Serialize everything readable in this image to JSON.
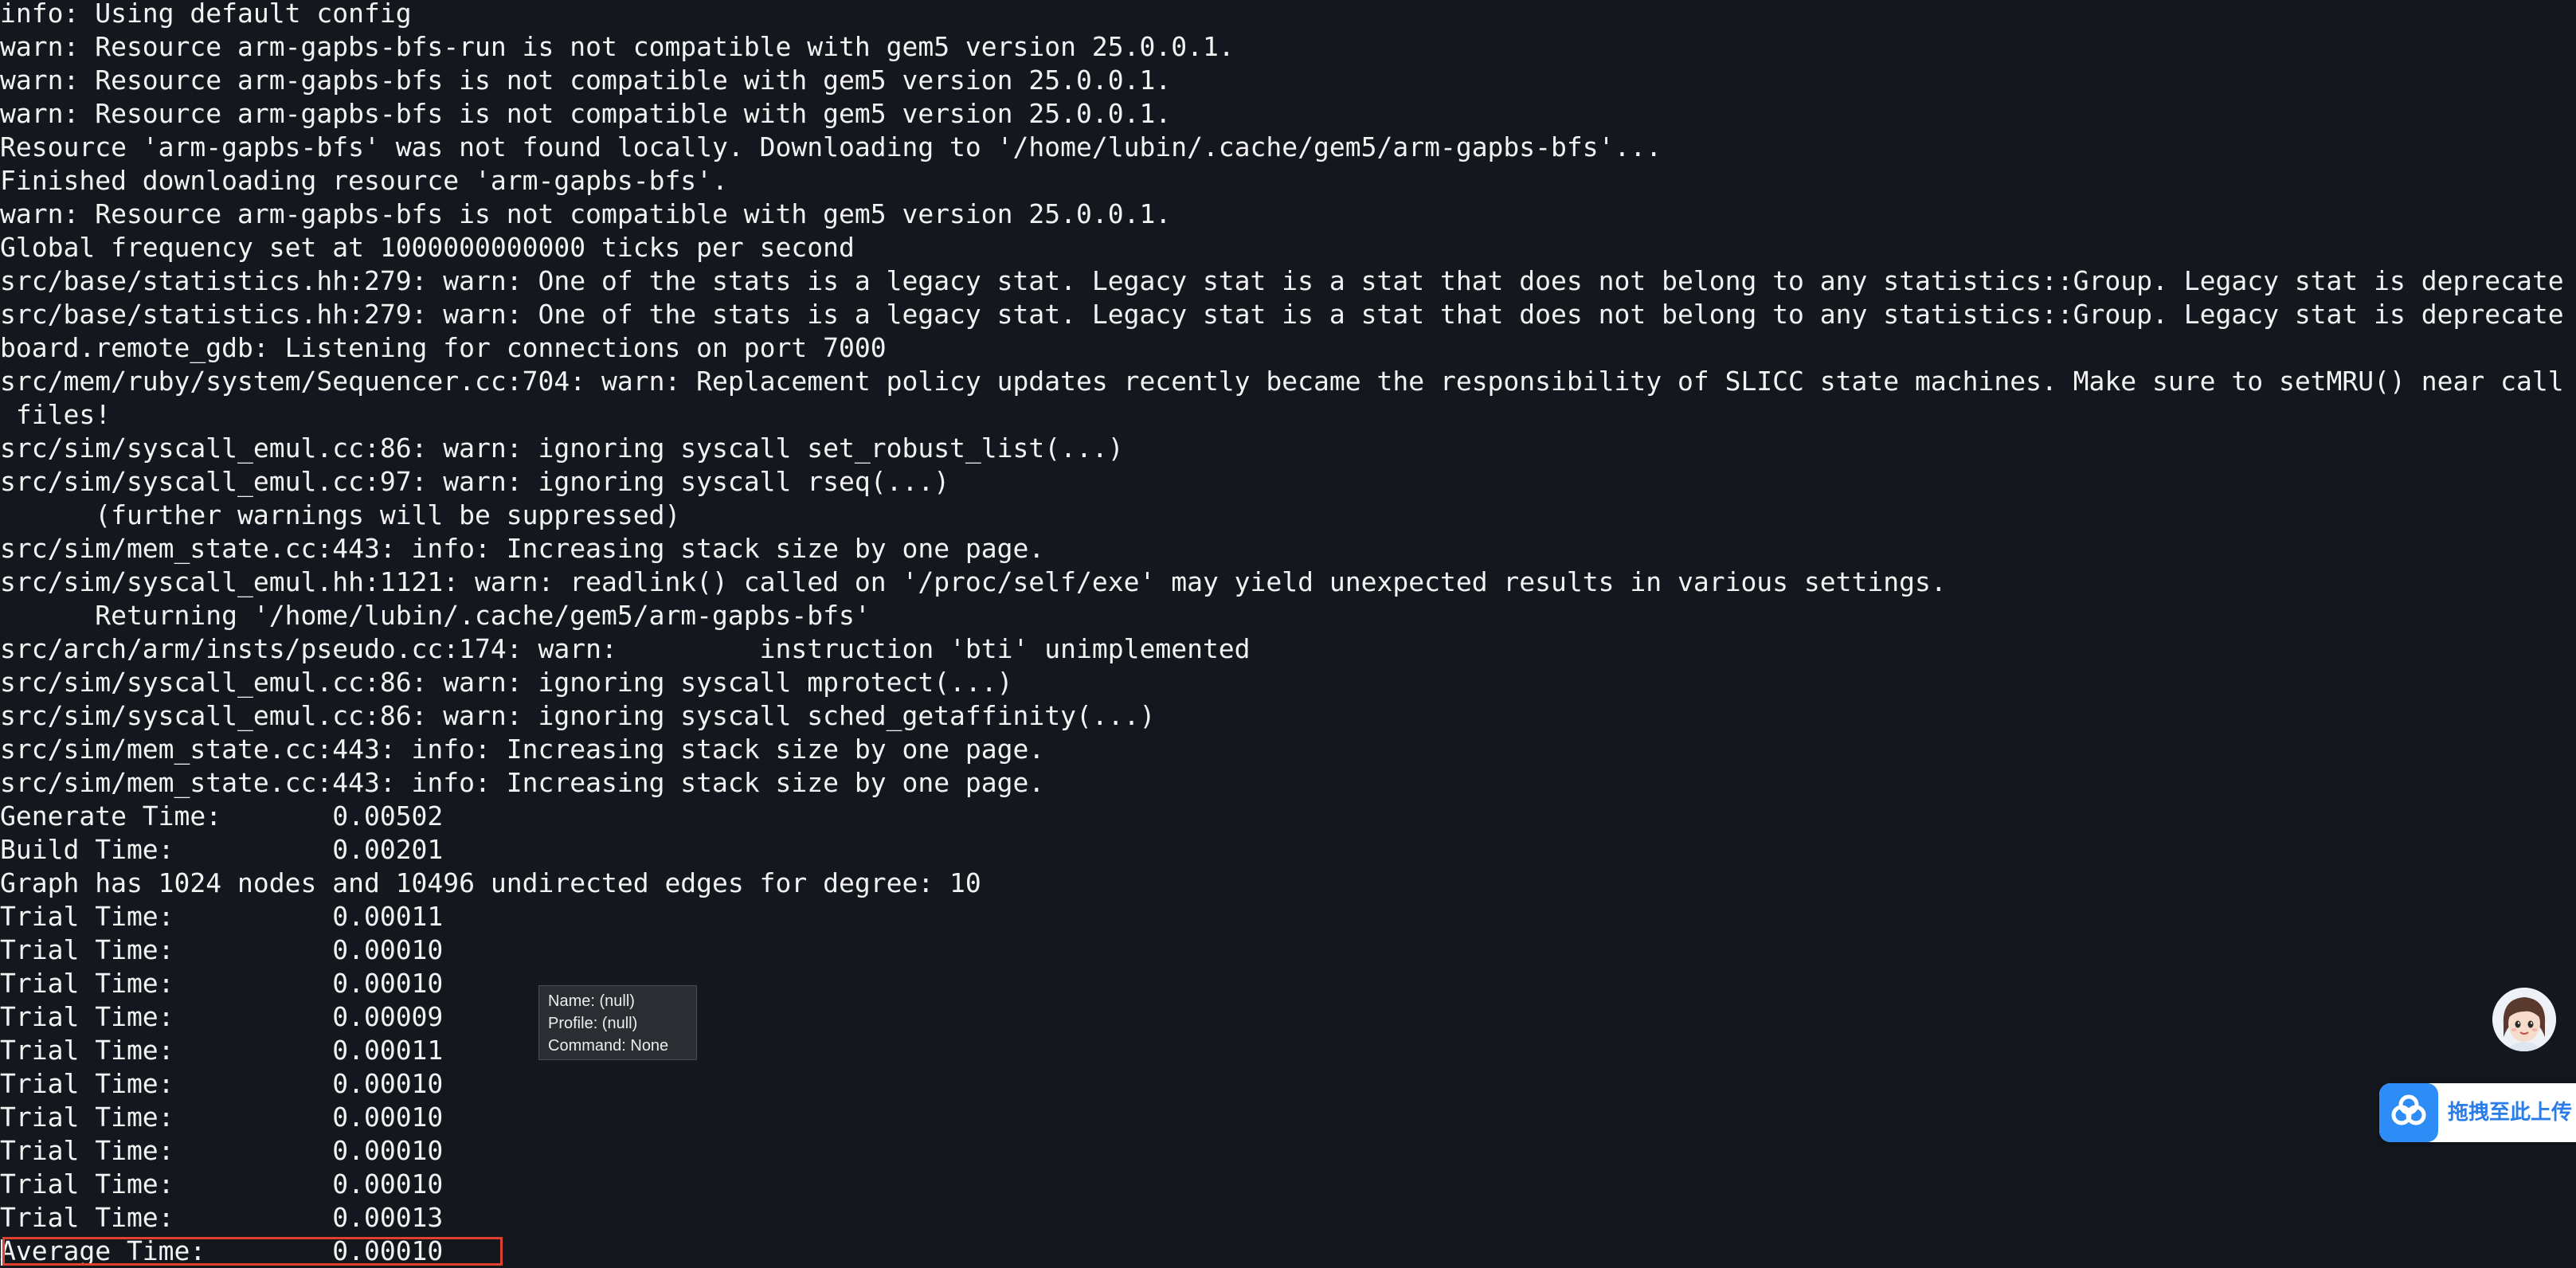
{
  "terminal": {
    "lines": [
      "info: Using default config",
      "warn: Resource arm-gapbs-bfs-run is not compatible with gem5 version 25.0.0.1.",
      "warn: Resource arm-gapbs-bfs is not compatible with gem5 version 25.0.0.1.",
      "warn: Resource arm-gapbs-bfs is not compatible with gem5 version 25.0.0.1.",
      "Resource 'arm-gapbs-bfs' was not found locally. Downloading to '/home/lubin/.cache/gem5/arm-gapbs-bfs'...",
      "Finished downloading resource 'arm-gapbs-bfs'.",
      "warn: Resource arm-gapbs-bfs is not compatible with gem5 version 25.0.0.1.",
      "Global frequency set at 1000000000000 ticks per second",
      "src/base/statistics.hh:279: warn: One of the stats is a legacy stat. Legacy stat is a stat that does not belong to any statistics::Group. Legacy stat is deprecate",
      "src/base/statistics.hh:279: warn: One of the stats is a legacy stat. Legacy stat is a stat that does not belong to any statistics::Group. Legacy stat is deprecate",
      "board.remote_gdb: Listening for connections on port 7000",
      "src/mem/ruby/system/Sequencer.cc:704: warn: Replacement policy updates recently became the responsibility of SLICC state machines. Make sure to setMRU() near call",
      " files!",
      "src/sim/syscall_emul.cc:86: warn: ignoring syscall set_robust_list(...)",
      "src/sim/syscall_emul.cc:97: warn: ignoring syscall rseq(...)",
      "      (further warnings will be suppressed)",
      "src/sim/mem_state.cc:443: info: Increasing stack size by one page.",
      "src/sim/syscall_emul.hh:1121: warn: readlink() called on '/proc/self/exe' may yield unexpected results in various settings.",
      "      Returning '/home/lubin/.cache/gem5/arm-gapbs-bfs'",
      "src/arch/arm/insts/pseudo.cc:174: warn:         instruction 'bti' unimplemented",
      "src/sim/syscall_emul.cc:86: warn: ignoring syscall mprotect(...)",
      "src/sim/syscall_emul.cc:86: warn: ignoring syscall sched_getaffinity(...)",
      "src/sim/mem_state.cc:443: info: Increasing stack size by one page.",
      "src/sim/mem_state.cc:443: info: Increasing stack size by one page.",
      "Generate Time:       0.00502",
      "Build Time:          0.00201",
      "Graph has 1024 nodes and 10496 undirected edges for degree: 10",
      "Trial Time:          0.00011",
      "Trial Time:          0.00010",
      "Trial Time:          0.00010",
      "Trial Time:          0.00009",
      "Trial Time:          0.00011",
      "Trial Time:          0.00010",
      "Trial Time:          0.00010",
      "Trial Time:          0.00010",
      "Trial Time:          0.00010",
      "Trial Time:          0.00013",
      "Average Time:        0.00010"
    ]
  },
  "tooltip": {
    "name": "Name: (null)",
    "profile": "Profile: (null)",
    "command": "Command: None"
  },
  "upload_widget": {
    "label": "拖拽至此上传",
    "icon": "cloud-upload-icon"
  },
  "avatar": {
    "icon": "assistant-avatar-icon"
  },
  "colors": {
    "background": "#14181e",
    "text": "#f2f2f2",
    "highlight": "#e0412f",
    "upload_accent": "#2d8cf5"
  }
}
